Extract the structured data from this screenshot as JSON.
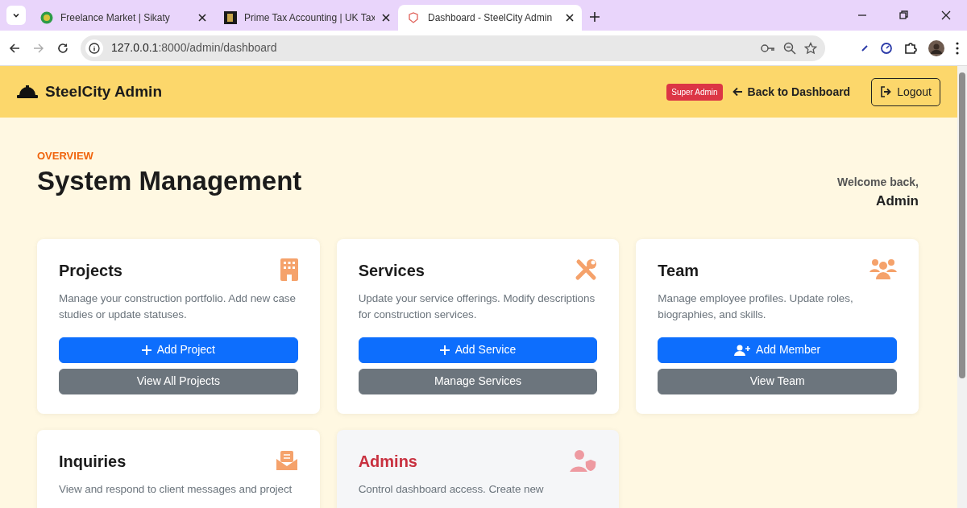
{
  "browser": {
    "tabs": [
      {
        "title": "Freelance Market | Sikaty",
        "selected": false
      },
      {
        "title": "Prime Tax Accounting | UK Tax",
        "selected": false
      },
      {
        "title": "Dashboard - SteelCity Admin",
        "selected": true
      }
    ],
    "address": {
      "host": "127.0.0.1",
      "path": ":8000/admin/dashboard"
    }
  },
  "header": {
    "brand": "SteelCity Admin",
    "role_badge": "Super Admin",
    "back_link": "Back to Dashboard",
    "logout": "Logout"
  },
  "intro": {
    "eyebrow": "OVERVIEW",
    "title": "System Management",
    "welcome": "Welcome back,",
    "user": "Admin"
  },
  "cards": [
    {
      "kind": "standard",
      "title": "Projects",
      "description": "Manage your construction portfolio. Add new case studies or update statuses.",
      "buttons": [
        "Add Project",
        "View All Projects"
      ]
    },
    {
      "kind": "standard",
      "title": "Services",
      "description": "Update your service offerings. Modify descriptions for construction services.",
      "buttons": [
        "Add Service",
        "Manage Services"
      ]
    },
    {
      "kind": "standard",
      "title": "Team",
      "description": "Manage employee profiles. Update roles, biographies, and skills.",
      "buttons": [
        "Add Member",
        "View Team"
      ]
    },
    {
      "kind": "standard",
      "title": "Inquiries",
      "description": "View and respond to client messages and project"
    },
    {
      "kind": "restricted",
      "title": "Admins",
      "description": "Control dashboard access. Create new"
    }
  ]
}
